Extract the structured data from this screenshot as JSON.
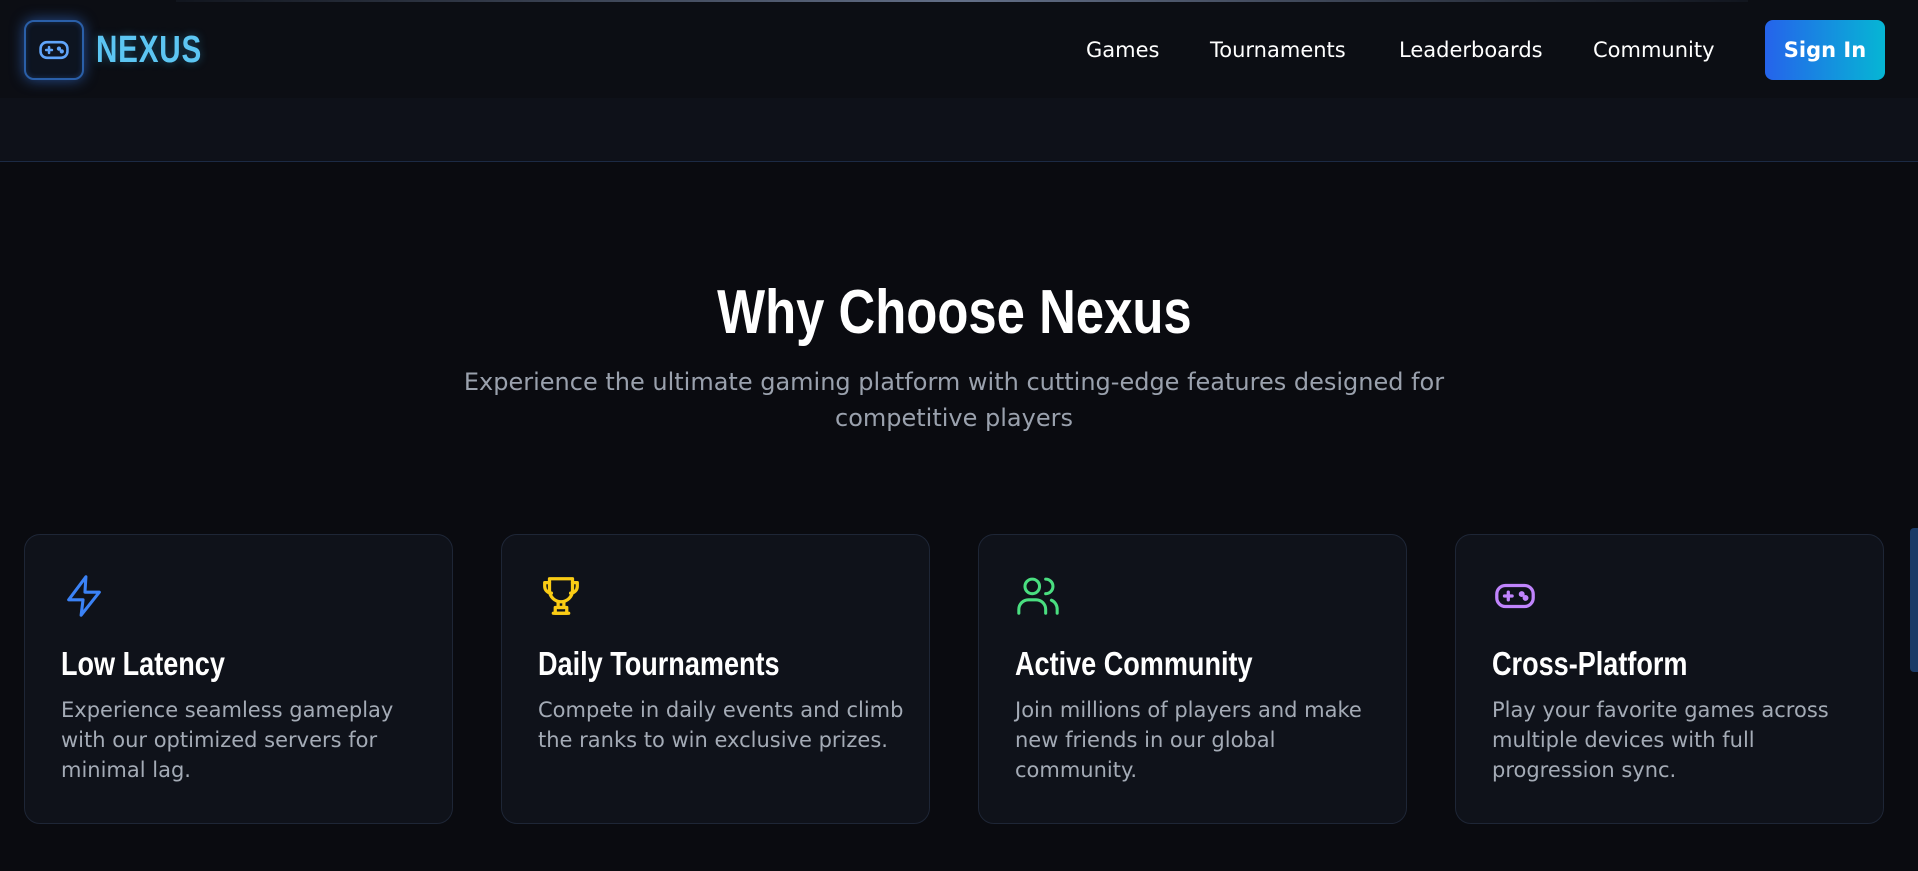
{
  "brand": {
    "name": "NEXUS",
    "logo_icon": "gamepad-icon",
    "accent": "#5cc6f3"
  },
  "nav": {
    "links": [
      "Games",
      "Tournaments",
      "Leaderboards",
      "Community"
    ],
    "signin_label": "Sign In",
    "signin_gradient": [
      "#2563eb",
      "#06b6d4"
    ]
  },
  "section": {
    "title": "Why Choose Nexus",
    "subtitle": "Experience the ultimate gaming platform with cutting-edge features designed for competitive players"
  },
  "features": [
    {
      "icon": "lightning-icon",
      "icon_color": "#3b82f6",
      "title": "Low Latency",
      "description": "Experience seamless gameplay with our optimized servers for minimal lag."
    },
    {
      "icon": "trophy-icon",
      "icon_color": "#facc15",
      "title": "Daily Tournaments",
      "description": "Compete in daily events and climb the ranks to win exclusive prizes."
    },
    {
      "icon": "users-icon",
      "icon_color": "#4ade80",
      "title": "Active Community",
      "description": "Join millions of players and make new friends in our global community."
    },
    {
      "icon": "gamepad-icon",
      "icon_color": "#c084fc",
      "title": "Cross-Platform",
      "description": "Play your favorite games across multiple devices with full progression sync."
    }
  ]
}
